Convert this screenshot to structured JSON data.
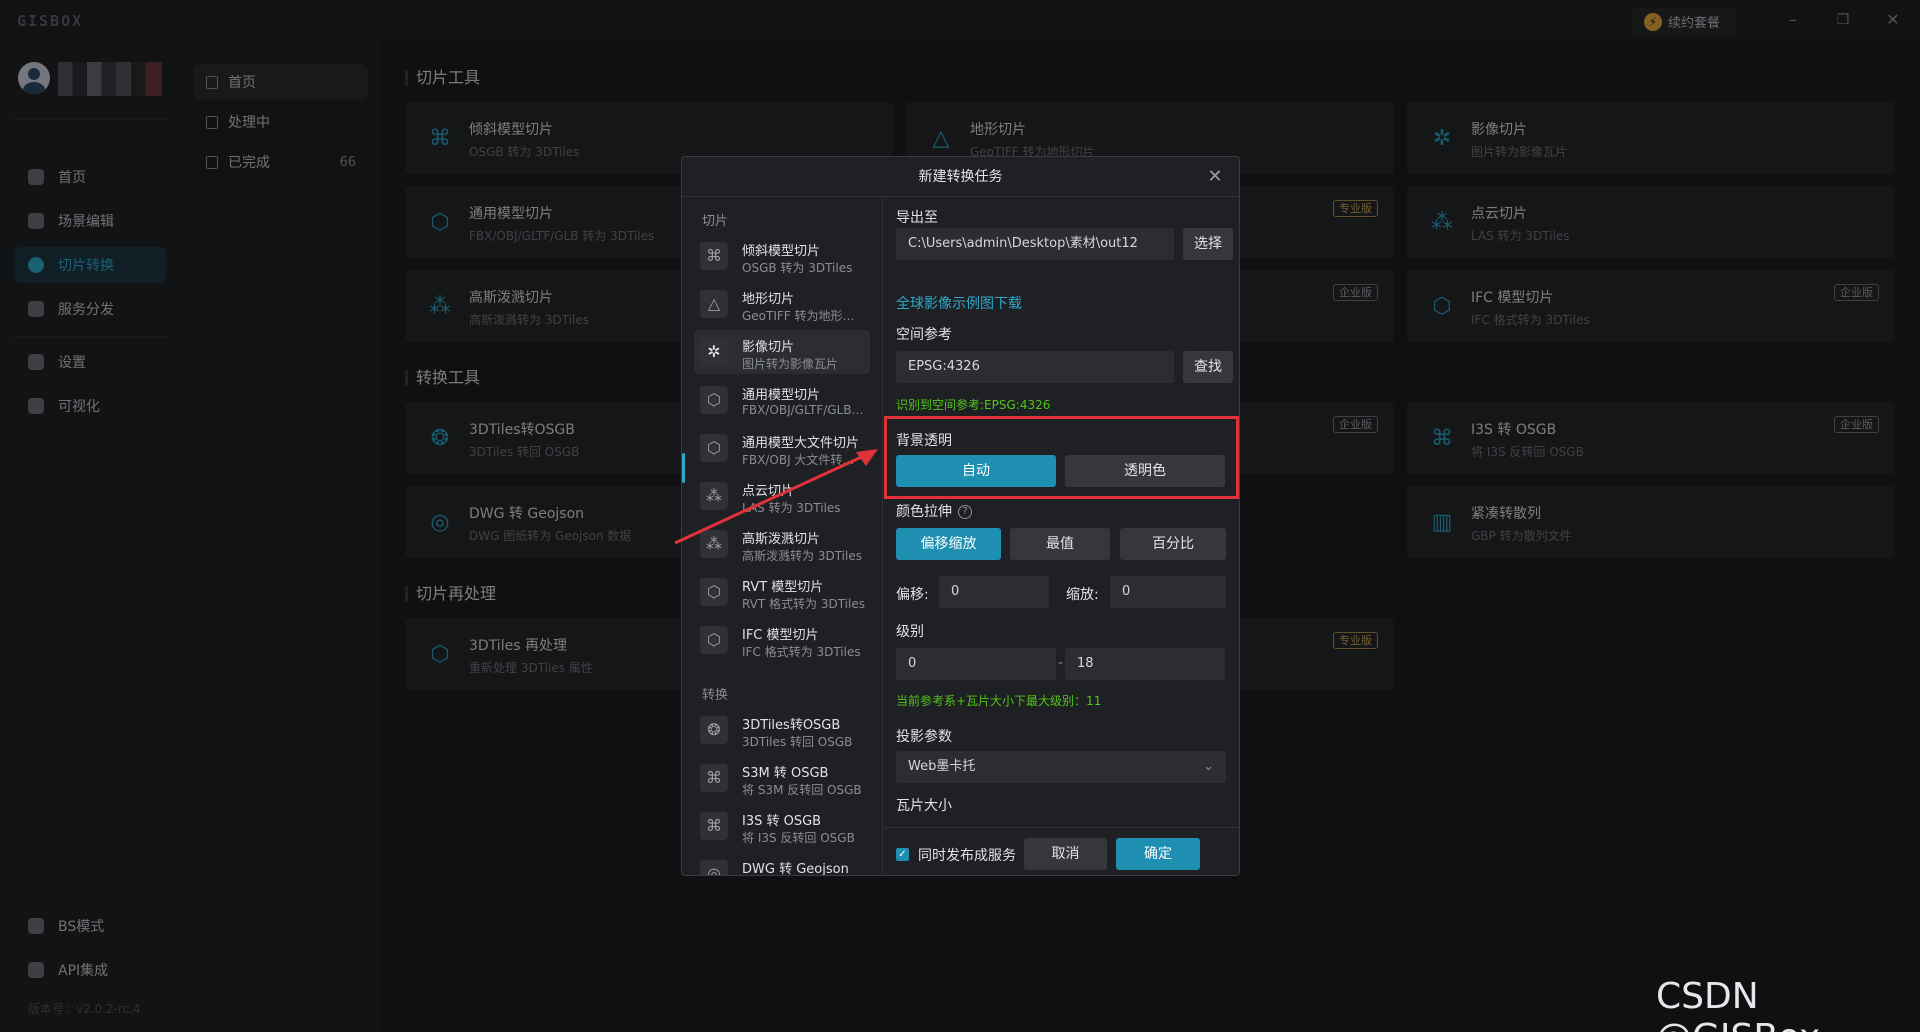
{
  "app": {
    "logo": "GISBOX",
    "renew": "续约套餐",
    "min": "–",
    "max": "❐",
    "close": "✕",
    "version": "版本号：v2.0.2-rc.4"
  },
  "nav": {
    "items": [
      {
        "label": "首页",
        "icon": "home-icon"
      },
      {
        "label": "场景编辑",
        "icon": "cube-icon"
      },
      {
        "label": "切片转换",
        "icon": "convert-icon"
      },
      {
        "label": "服务分发",
        "icon": "upload-icon"
      },
      {
        "label": "设置",
        "icon": "gear-icon"
      },
      {
        "label": "可视化",
        "icon": "visual-icon"
      }
    ],
    "bottom": [
      {
        "label": "BS模式"
      },
      {
        "label": "API集成"
      }
    ]
  },
  "tasks": {
    "items": [
      {
        "label": "首页"
      },
      {
        "label": "处理中"
      },
      {
        "label": "已完成",
        "count": "66"
      }
    ]
  },
  "sections": {
    "slice": "切片工具",
    "convert": "转换工具",
    "post": "切片再处理"
  },
  "cards": {
    "c1": {
      "title": "倾斜模型切片",
      "sub": "OSGB 转为 3DTiles"
    },
    "c2": {
      "title": "地形切片",
      "sub": "GeoTIFF 转为地形切片"
    },
    "c3": {
      "title": "影像切片",
      "sub": "图片转为影像瓦片"
    },
    "c4": {
      "title": "通用模型切片",
      "sub": "FBX/OBJ/GLTF/GLB 转为 3DTiles"
    },
    "c5": {
      "badge": "专业版"
    },
    "c6": {
      "title": "点云切片",
      "sub": "LAS 转为 3DTiles"
    },
    "c7": {
      "title": "高斯泼溅切片",
      "sub": "高斯泼溅转为 3DTiles"
    },
    "c8": {
      "badge": "企业版"
    },
    "c9": {
      "title": "IFC 模型切片",
      "sub": "IFC 格式转为 3DTiles",
      "badge": "企业版"
    },
    "c10": {
      "title": "3DTiles转OSGB",
      "sub": "3DTiles 转回 OSGB"
    },
    "c11": {
      "badge": "企业版"
    },
    "c12": {
      "title": "I3S 转 OSGB",
      "sub": "将 I3S 反转回 OSGB",
      "badge": "企业版"
    },
    "c13": {
      "title": "DWG 转 Geojson",
      "sub": "DWG 图纸转为 Geojson 数据"
    },
    "c14": {
      "title": "紧凑转散列",
      "sub": "GBP 转为散列文件"
    },
    "c15": {
      "title": "3DTiles 再处理",
      "sub": "重新处理 3DTiles 属性"
    },
    "c16": {
      "badge": "专业版"
    }
  },
  "dialog": {
    "title": "新建转换任务",
    "close": "✕",
    "group_slice": "切片",
    "group_convert": "转换",
    "list": [
      {
        "title": "倾斜模型切片",
        "sub": "OSGB 转为 3DTiles"
      },
      {
        "title": "地形切片",
        "sub": "GeoTIFF 转为地形…"
      },
      {
        "title": "影像切片",
        "sub": "图片转为影像瓦片"
      },
      {
        "title": "通用模型切片",
        "sub": "FBX/OBJ/GLTF/GLB…"
      },
      {
        "title": "通用模型大文件切片",
        "sub": "FBX/OBJ 大文件转…"
      },
      {
        "title": "点云切片",
        "sub": "LAS 转为 3DTiles"
      },
      {
        "title": "高斯泼溅切片",
        "sub": "高斯泼溅转为 3DTiles"
      },
      {
        "title": "RVT 模型切片",
        "sub": "RVT 格式转为 3DTiles"
      },
      {
        "title": "IFC 模型切片",
        "sub": "IFC 格式转为 3DTiles"
      },
      {
        "title": "3DTiles转OSGB",
        "sub": "3DTiles 转回 OSGB"
      },
      {
        "title": "S3M 转 OSGB",
        "sub": "将 S3M 反转回 OSGB"
      },
      {
        "title": "I3S 转 OSGB",
        "sub": "将 I3S 反转回 OSGB"
      },
      {
        "title": "DWG 转 Geojson",
        "sub": ""
      }
    ],
    "export_label": "导出至",
    "export_path": "C:\\Users\\admin\\Desktop\\素材\\out12",
    "choose": "选择",
    "download_link": "全球影像示例图下载",
    "srs_label": "空间参考",
    "srs_value": "EPSG:4326",
    "find": "查找",
    "srs_hint": "识别到空间参考:EPSG:4326",
    "bg_label": "背景透明",
    "bg_auto": "自动",
    "bg_transparent": "透明色",
    "stretch_label": "颜色拉伸",
    "stretch_opts": [
      "偏移缩放",
      "最值",
      "百分比"
    ],
    "offset_label": "偏移:",
    "offset_value": "0",
    "scale_label": "缩放:",
    "scale_value": "0",
    "level_label": "级别",
    "level_min": "0",
    "level_sep": "-",
    "level_max": "18",
    "level_hint": "当前参考系+瓦片大小下最大级别：11",
    "proj_label": "投影参数",
    "proj_value": "Web墨卡托",
    "tile_label": "瓦片大小",
    "publish": "同时发布成服务",
    "cancel": "取消",
    "ok": "确定"
  },
  "watermark": "CSDN @GISBox",
  "colors": {
    "accent": "#1e8fb0",
    "highlight": "#e0323a"
  }
}
